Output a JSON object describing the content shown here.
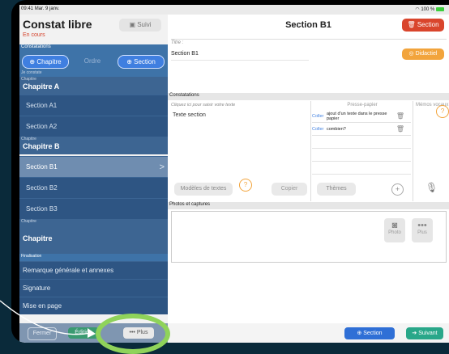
{
  "status": {
    "time": "09:41",
    "date": "Mar. 9 janv.",
    "battery": "100 %"
  },
  "sidebar": {
    "app_title": "Constat libre",
    "app_status": "En cours",
    "suivi_label": "Suivi",
    "constatations_header": "Constatations",
    "je_constate": "Je constate",
    "chapitre_btn": "Chapitre",
    "ordre_btn": "Ordre",
    "section_btn": "Section",
    "chapter_sublabel": "Chapitre",
    "chapters": [
      {
        "title": "Chapitre A",
        "sections": [
          "Section A1",
          "Section A2"
        ]
      },
      {
        "title": "Chapitre B",
        "sections": [
          "Section B1",
          "Section B2",
          "Section B3"
        ]
      },
      {
        "title": "Chapitre",
        "sections": []
      }
    ],
    "finalisation_header": "Finalisation",
    "finalisation_items": [
      "Remarque générale et annexes",
      "Signature",
      "Mise en page"
    ],
    "bottom": {
      "a": "Fermer",
      "b": "Édition",
      "c": "Plus"
    }
  },
  "main": {
    "title": "Section B1",
    "section_button": "Section",
    "didactiel": "Didactiel",
    "titre_label": "Titre :",
    "titre_value": "Section B1",
    "constatations_bar": "Constatations",
    "hint": "Cliquez ici pour saisir votre texte",
    "text_section": "Texte section",
    "modeles": "Modèles de textes",
    "copier": "Copier",
    "presse_papier_header": "Presse-papier",
    "coller": "Coller",
    "clipboard": [
      "ajout d'un texte dans le presse papier",
      "combien?"
    ],
    "themes": "Thèmes",
    "memos_header": "Mémos vocaux",
    "photos_bar": "Photos et captures",
    "photo_btn": "Photo",
    "plus_btn": "Plus",
    "bottom_section": "Section",
    "bottom_suivant": "Suivant"
  }
}
